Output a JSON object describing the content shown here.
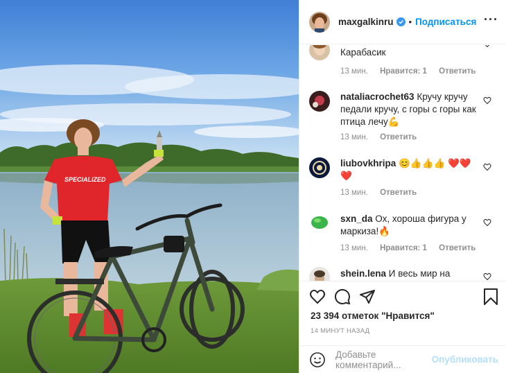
{
  "post": {
    "username": "maxgalkinru",
    "follow_label": "Подписаться",
    "separator": "•",
    "more_label": "···"
  },
  "comments": [
    {
      "author": "",
      "text": "Карабасик",
      "time": "13 мин.",
      "likes": "Нравится: 1",
      "reply": "Ответить"
    },
    {
      "author": "nataliacrochet63",
      "text": "Кручу кручу педали кручу, с горы с горы как птица лечу💪",
      "time": "13 мин.",
      "likes": "",
      "reply": "Ответить"
    },
    {
      "author": "liubovkhripa",
      "text": "😊👍👍👍 ❤️❤️❤️",
      "time": "13 мин.",
      "likes": "",
      "reply": "Ответить"
    },
    {
      "author": "sxn_da",
      "text": "Ох, хороша фигура у маркиза!🔥",
      "time": "13 мин.",
      "likes": "Нравится: 1",
      "reply": "Ответить"
    },
    {
      "author": "shein.lena",
      "text": "И весь мир на",
      "time": "",
      "likes": "",
      "reply": ""
    }
  ],
  "footer": {
    "likes_text": "23 394 отметок \"Нравится\"",
    "timestamp": "14 МИНУТ НАЗАД",
    "comment_placeholder": "Добавьте комментарий...",
    "publish_label": "Опубликовать"
  },
  "colors": {
    "accent": "#0095f6",
    "publish_disabled": "#b2dffc",
    "meta_gray": "#8e8e8e"
  }
}
